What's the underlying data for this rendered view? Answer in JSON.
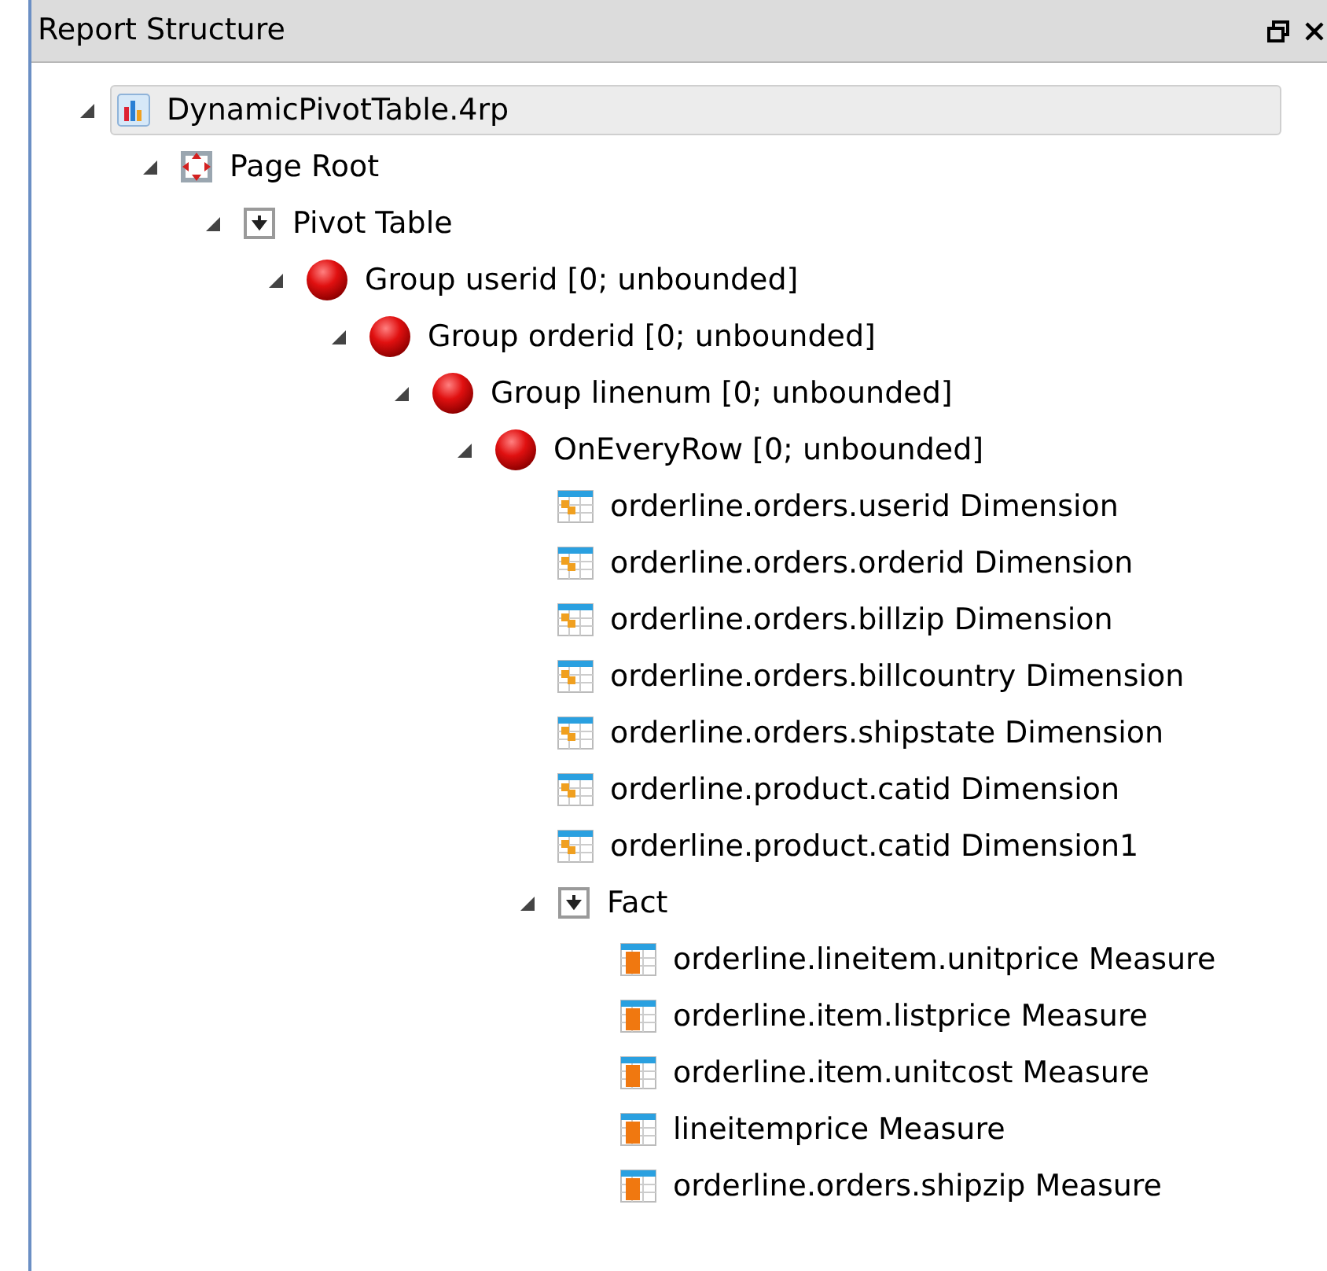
{
  "panel": {
    "title": "Report Structure"
  },
  "tree": [
    {
      "kind": "file",
      "label": "DynamicPivotTable.4rp",
      "selected": true,
      "expanded": true,
      "children": [
        {
          "kind": "page",
          "label": "Page Root",
          "selected": false,
          "expanded": true,
          "children": [
            {
              "kind": "pivot",
              "label": "Pivot Table",
              "selected": false,
              "expanded": true,
              "children": [
                {
                  "kind": "group",
                  "label": "Group userid [0; unbounded]",
                  "selected": false,
                  "expanded": true,
                  "children": [
                    {
                      "kind": "group",
                      "label": "Group orderid [0; unbounded]",
                      "selected": false,
                      "expanded": true,
                      "children": [
                        {
                          "kind": "group",
                          "label": "Group linenum [0; unbounded]",
                          "selected": false,
                          "expanded": true,
                          "children": [
                            {
                              "kind": "group",
                              "label": "OnEveryRow [0; unbounded]",
                              "selected": false,
                              "expanded": true,
                              "children": [
                                {
                                  "kind": "dimension",
                                  "label": "orderline.orders.userid Dimension",
                                  "selected": false
                                },
                                {
                                  "kind": "dimension",
                                  "label": "orderline.orders.orderid Dimension",
                                  "selected": false
                                },
                                {
                                  "kind": "dimension",
                                  "label": "orderline.orders.billzip Dimension",
                                  "selected": false
                                },
                                {
                                  "kind": "dimension",
                                  "label": "orderline.orders.billcountry Dimension",
                                  "selected": false
                                },
                                {
                                  "kind": "dimension",
                                  "label": "orderline.orders.shipstate Dimension",
                                  "selected": false
                                },
                                {
                                  "kind": "dimension",
                                  "label": "orderline.product.catid Dimension",
                                  "selected": false
                                },
                                {
                                  "kind": "dimension",
                                  "label": "orderline.product.catid Dimension1",
                                  "selected": false
                                },
                                {
                                  "kind": "pivot",
                                  "label": "Fact",
                                  "selected": false,
                                  "expanded": true,
                                  "children": [
                                    {
                                      "kind": "measure",
                                      "label": "orderline.lineitem.unitprice Measure",
                                      "selected": false
                                    },
                                    {
                                      "kind": "measure",
                                      "label": "orderline.item.listprice Measure",
                                      "selected": false
                                    },
                                    {
                                      "kind": "measure",
                                      "label": "orderline.item.unitcost Measure",
                                      "selected": false
                                    },
                                    {
                                      "kind": "measure",
                                      "label": "lineitemprice Measure",
                                      "selected": false
                                    },
                                    {
                                      "kind": "measure",
                                      "label": "orderline.orders.shipzip Measure",
                                      "selected": false
                                    }
                                  ]
                                }
                              ]
                            }
                          ]
                        }
                      ]
                    }
                  ]
                }
              ]
            }
          ]
        }
      ]
    }
  ]
}
